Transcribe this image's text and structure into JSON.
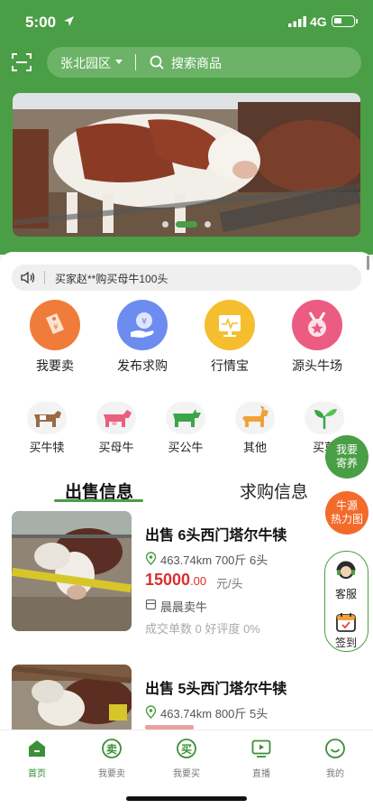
{
  "status": {
    "time": "5:00",
    "network": "4G"
  },
  "header": {
    "region": "张北园区",
    "search_placeholder": "搜索商品"
  },
  "notice": {
    "text": "买家赵**购买母牛100头"
  },
  "quick_actions": [
    {
      "label": "我要卖",
      "icon": "price-tag-icon",
      "color": "#f07c3c"
    },
    {
      "label": "发布求购",
      "icon": "yen-hand-icon",
      "color": "#6c8cf0"
    },
    {
      "label": "行情宝",
      "icon": "market-chart-icon",
      "color": "#f5be2e"
    },
    {
      "label": "源头牛场",
      "icon": "medal-icon",
      "color": "#ec5b82"
    }
  ],
  "categories": [
    {
      "label": "买牛犊",
      "icon": "calf-icon"
    },
    {
      "label": "买母牛",
      "icon": "cow-icon"
    },
    {
      "label": "买公牛",
      "icon": "bull-icon"
    },
    {
      "label": "其他",
      "icon": "horse-icon"
    },
    {
      "label": "买草",
      "icon": "sprout-icon"
    }
  ],
  "tabs": {
    "sale": "出售信息",
    "buy": "求购信息"
  },
  "listings": [
    {
      "title": "出售 6头西门塔尔牛犊",
      "distance": "463.74km",
      "weight": "700斤",
      "count": "6头",
      "price_main": "15000",
      "price_decimal": ".00",
      "unit": "元/头",
      "seller": "晨晨卖牛",
      "stats": "成交单数 0   好评度 0%"
    },
    {
      "title": "出售 5头西门塔尔牛犊",
      "distance": "463.74km",
      "weight": "800斤",
      "count": "5头",
      "price_main": "",
      "price_decimal": "",
      "unit": "",
      "seller": "",
      "stats": ""
    }
  ],
  "floating": {
    "raise": "我要\n寄养",
    "heatmap": "牛源\n热力图",
    "service": "客服",
    "checkin": "签到"
  },
  "tabbar": [
    {
      "label": "首页",
      "icon": "home-icon",
      "active": true
    },
    {
      "label": "我要卖",
      "icon": "sell-icon",
      "active": false
    },
    {
      "label": "我要买",
      "icon": "buy-icon",
      "active": false
    },
    {
      "label": "直播",
      "icon": "live-icon",
      "active": false
    },
    {
      "label": "我的",
      "icon": "profile-icon",
      "active": false
    }
  ],
  "colors": {
    "brand": "#4a9e45",
    "price": "#d92f2f",
    "float_orange": "#f36a2a"
  }
}
